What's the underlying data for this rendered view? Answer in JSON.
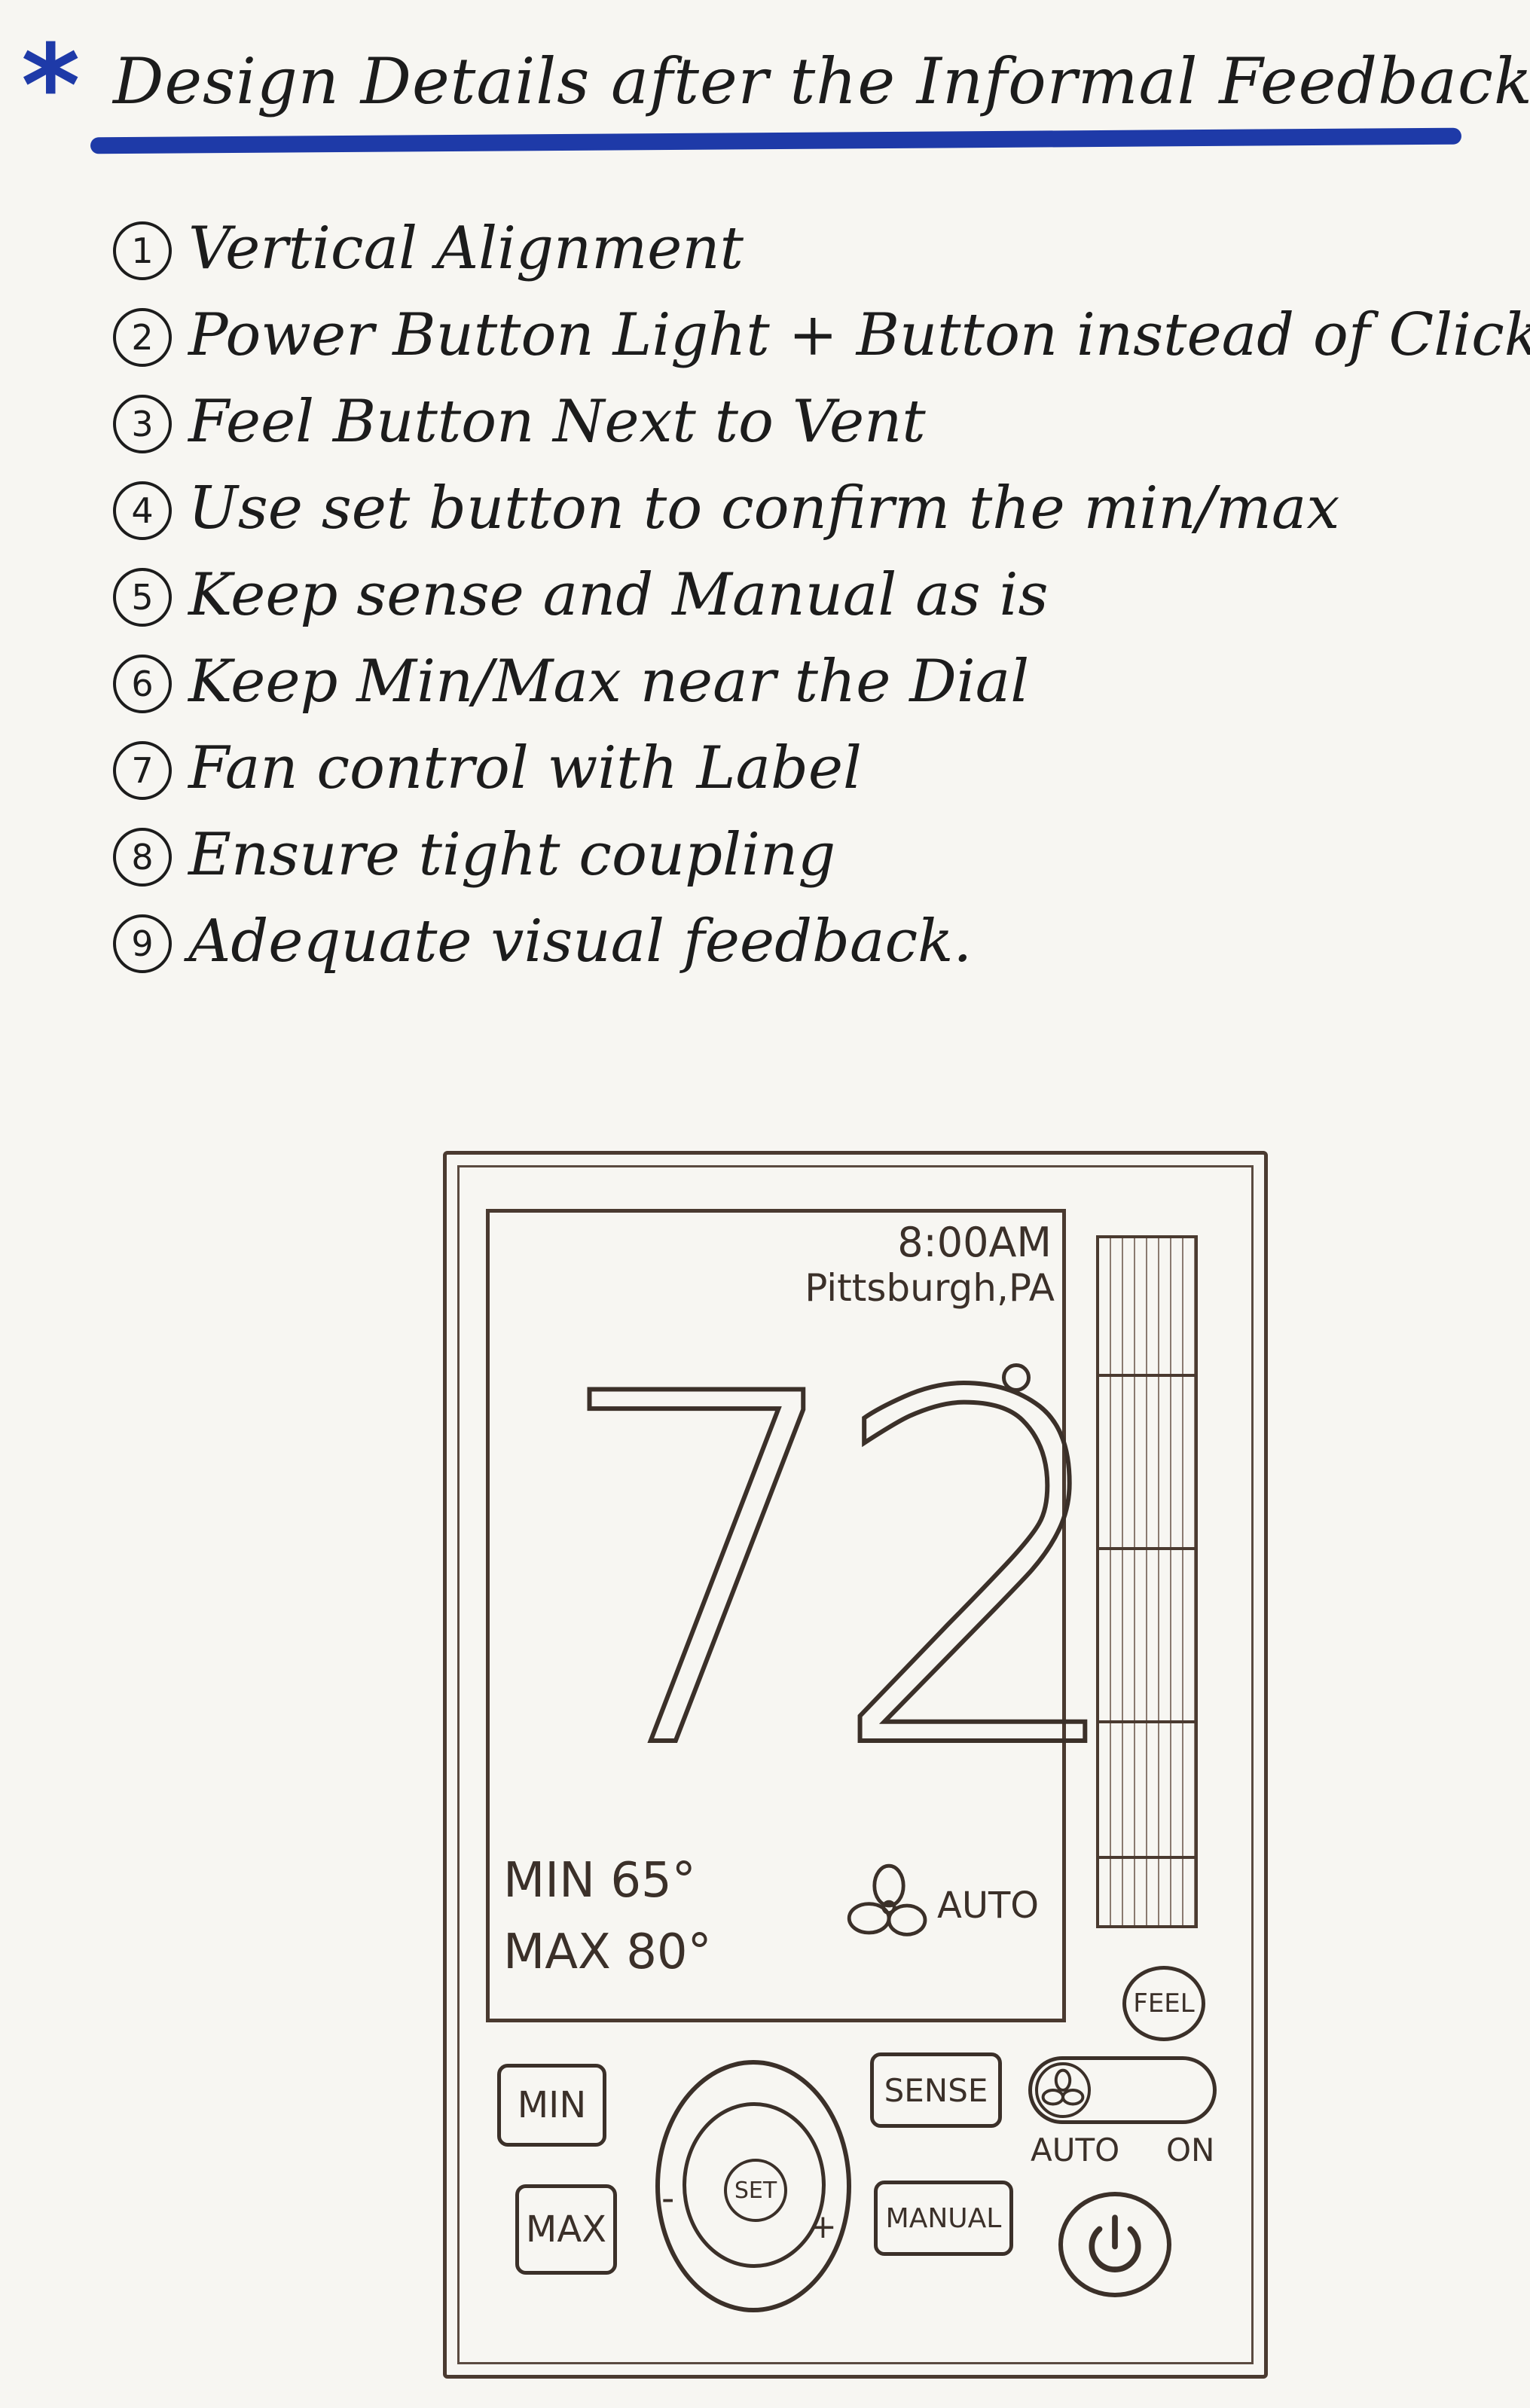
{
  "header": {
    "title": "Design Details after the Informal Feedback"
  },
  "items": [
    {
      "num": "1",
      "text": "Vertical Alignment"
    },
    {
      "num": "2",
      "text": "Power Button Light + Button instead of Click"
    },
    {
      "num": "3",
      "text": "Feel Button Next to Vent"
    },
    {
      "num": "4",
      "text": "Use set button to confirm the min/max"
    },
    {
      "num": "5",
      "text": "Keep sense and Manual as is"
    },
    {
      "num": "6",
      "text": "Keep Min/Max near the Dial"
    },
    {
      "num": "7",
      "text": "Fan control with Label"
    },
    {
      "num": "8",
      "text": "Ensure tight coupling"
    },
    {
      "num": "9",
      "text": "Adequate visual feedback."
    }
  ],
  "device": {
    "screen": {
      "time": "8:00AM",
      "location": "Pittsburgh,PA",
      "temperature": "72",
      "min_label": "MIN 65°",
      "max_label": "MAX 80°",
      "fan_status": "AUTO"
    },
    "buttons": {
      "min": "MIN",
      "max": "MAX",
      "sense": "SENSE",
      "manual": "MANUAL",
      "set": "SET",
      "feel": "FEEL"
    },
    "dial": {
      "minus": "-",
      "plus": "+"
    },
    "fan_toggle": {
      "auto": "AUTO",
      "on": "ON"
    }
  },
  "colors": {
    "ink": "#1c1c1c",
    "accent_blue": "#1e3aa8",
    "pencil": "#3b3029",
    "paper": "#f7f6f2"
  }
}
